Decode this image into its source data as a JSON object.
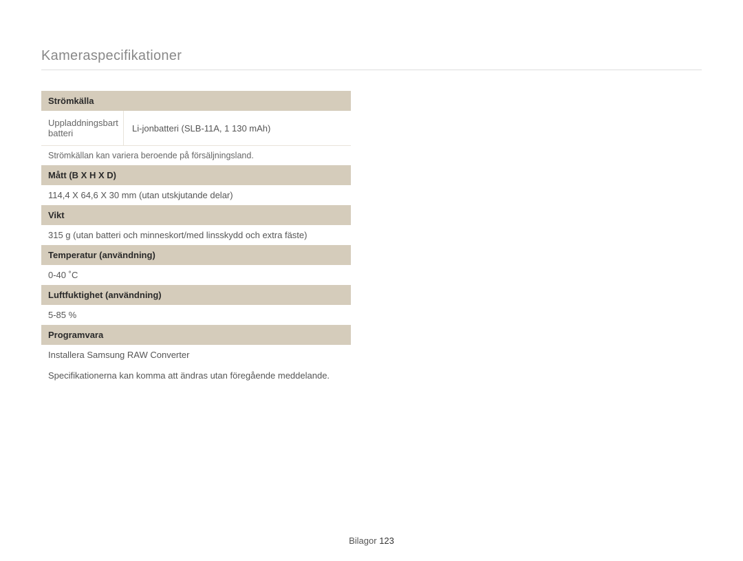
{
  "page_title": "Kameraspecifikationer",
  "specs": {
    "power_source": {
      "header": "Strömkälla",
      "row_label": "Uppladdningsbart batteri",
      "row_value": "Li-jonbatteri (SLB-11A, 1 130 mAh)",
      "note": "Strömkällan kan variera beroende på försäljningsland."
    },
    "dimensions": {
      "header": "Mått (B X H X D)",
      "value": "114,4 X 64,6 X 30 mm (utan utskjutande delar)"
    },
    "weight": {
      "header": "Vikt",
      "value": "315 g (utan batteri och minneskort/med linsskydd och extra fäste)"
    },
    "temperature": {
      "header": "Temperatur (användning)",
      "value": "0-40 ˚C"
    },
    "humidity": {
      "header": "Luftfuktighet (användning)",
      "value": "5-85 %"
    },
    "software": {
      "header": "Programvara",
      "value": "Installera Samsung RAW Converter"
    }
  },
  "final_note": "Specifikationerna kan komma att ändras utan föregående meddelande.",
  "footer": {
    "section": "Bilagor",
    "page_number": "123"
  }
}
